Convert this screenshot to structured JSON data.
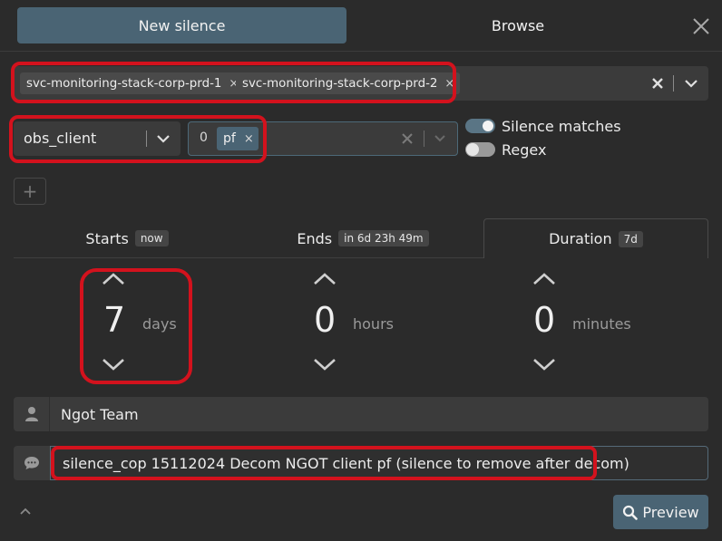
{
  "header": {
    "tabs": [
      {
        "label": "New silence",
        "active": true
      },
      {
        "label": "Browse",
        "active": false
      }
    ],
    "close_icon": "close-icon"
  },
  "matchers": {
    "label_values": [
      "svc-monitoring-stack-corp-prd-1",
      "svc-monitoring-stack-corp-prd-2"
    ],
    "chip_remove": "×",
    "name": "obs_client",
    "value_count": "0",
    "values": [
      "pf"
    ],
    "toggles": [
      {
        "label": "Silence matches",
        "on": true
      },
      {
        "label": "Regex",
        "on": false
      }
    ],
    "add_label": "+"
  },
  "time_tabs": [
    {
      "label": "Starts",
      "badge": "now",
      "active": false
    },
    {
      "label": "Ends",
      "badge": "in 6d 23h 49m",
      "active": false
    },
    {
      "label": "Duration",
      "badge": "7d",
      "active": true
    }
  ],
  "duration": {
    "days": {
      "value": "7",
      "unit": "days"
    },
    "hours": {
      "value": "0",
      "unit": "hours"
    },
    "minutes": {
      "value": "0",
      "unit": "minutes"
    }
  },
  "author": {
    "value": "Ngot Team",
    "icon": "user-icon"
  },
  "comment": {
    "value": "silence_cop 15112024 Decom NGOT client pf (silence to remove after decom)",
    "icon": "comment-icon"
  },
  "footer": {
    "preview_label": "Preview",
    "preview_icon": "search-icon"
  },
  "colors": {
    "accent": "#4a6474",
    "background": "#2b2b2b",
    "annotation": "#d3121d"
  }
}
